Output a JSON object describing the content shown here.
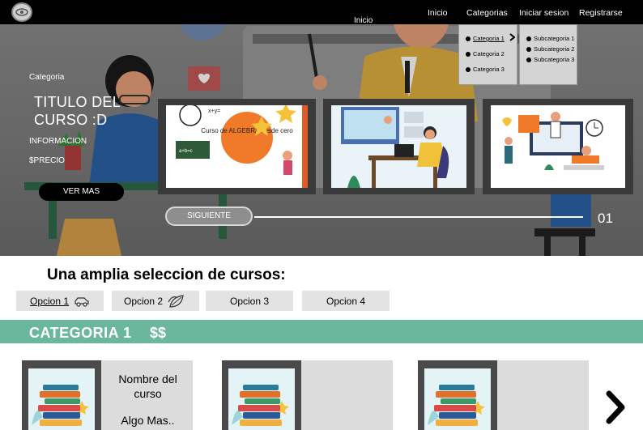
{
  "nav": {
    "floating_inicio": "Inicio",
    "items": [
      "Inicio",
      "Categorias",
      "Iniciar sesion",
      "Registrarse"
    ]
  },
  "dropdown": {
    "categories": [
      "Categoria 1",
      "Categoria 2",
      "Categoria 3"
    ],
    "subcategories": [
      "Subcategoria 1",
      "Subcategoria 2",
      "Subcategoria 3"
    ]
  },
  "hero": {
    "category": "Categoria",
    "title": "TITULO DEL CURSO  :D",
    "info": "INFORMACION",
    "price": "$PRECIO",
    "cta": "VER MAS",
    "next": "SIGUIENTE",
    "slide_number": "01",
    "thumb1_text": "Curso de ALGEBRA desde cero",
    "thumb1_eq": "x+y=",
    "thumb1_board": "a+b=c"
  },
  "selection": {
    "title": "Una amplia seleccion de cursos:",
    "options": [
      "Opcion 1",
      "Opcion 2",
      "Opcion 3",
      "Opcion 4"
    ]
  },
  "category_band": {
    "title": "CATEGORIA 1",
    "price_tag": "$$"
  },
  "cards": [
    {
      "name": "Nombre del curso",
      "more": "Algo Mas.."
    },
    {
      "name": "",
      "more": ""
    },
    {
      "name": "",
      "more": ""
    }
  ],
  "colors": {
    "accent_green": "#6bb79e",
    "nav_bg": "#000000",
    "option_bg": "#e3e3e3"
  }
}
